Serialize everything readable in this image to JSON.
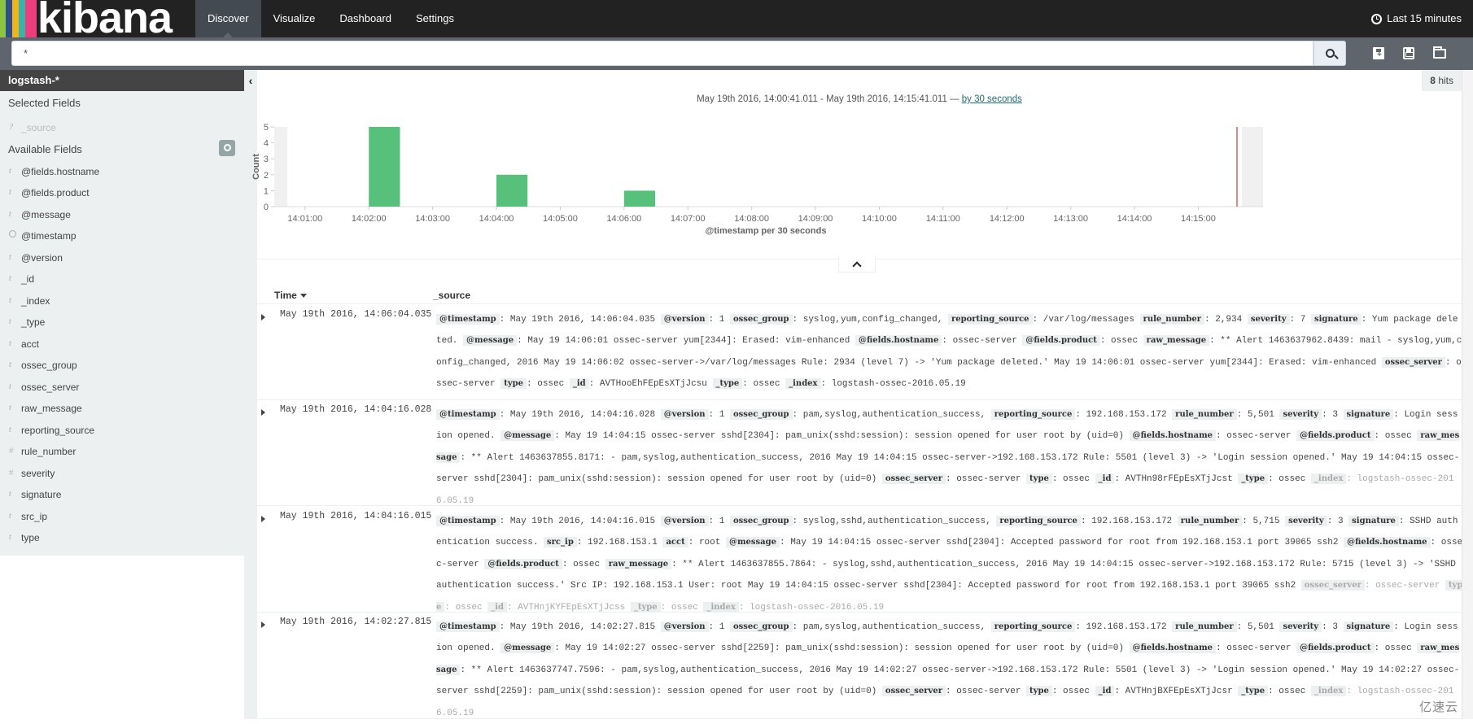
{
  "brand": {
    "name": "kibana",
    "stripe_colors": [
      "#8cc63f",
      "#2e4e8c",
      "#f0b51b",
      "#3bb3a9",
      "#ec3e7f"
    ]
  },
  "nav": {
    "tabs": [
      {
        "label": "Discover",
        "active": true
      },
      {
        "label": "Visualize",
        "active": false
      },
      {
        "label": "Dashboard",
        "active": false
      },
      {
        "label": "Settings",
        "active": false
      }
    ],
    "timepicker": {
      "icon": "clock-icon",
      "label": "Last 15 minutes"
    }
  },
  "search": {
    "query": "*",
    "button_icon": "search-icon",
    "tools": [
      {
        "name": "new-search",
        "icon": "new-document-icon"
      },
      {
        "name": "save-search",
        "icon": "save-icon"
      },
      {
        "name": "open-search",
        "icon": "folder-open-icon"
      }
    ]
  },
  "sidebar": {
    "index_pattern": "logstash-*",
    "selected_title": "Selected Fields",
    "selected_fields": [
      {
        "type": "?",
        "name": "_source"
      }
    ],
    "available_title": "Available Fields",
    "available_fields": [
      {
        "type": "t",
        "name": "@fields.hostname"
      },
      {
        "type": "t",
        "name": "@fields.product"
      },
      {
        "type": "t",
        "name": "@message"
      },
      {
        "type": "clock",
        "name": "@timestamp"
      },
      {
        "type": "t",
        "name": "@version"
      },
      {
        "type": "t",
        "name": "_id"
      },
      {
        "type": "t",
        "name": "_index"
      },
      {
        "type": "t",
        "name": "_type"
      },
      {
        "type": "t",
        "name": "acct"
      },
      {
        "type": "t",
        "name": "ossec_group"
      },
      {
        "type": "t",
        "name": "ossec_server"
      },
      {
        "type": "t",
        "name": "raw_message"
      },
      {
        "type": "t",
        "name": "reporting_source"
      },
      {
        "type": "#",
        "name": "rule_number"
      },
      {
        "type": "#",
        "name": "severity"
      },
      {
        "type": "t",
        "name": "signature"
      },
      {
        "type": "t",
        "name": "src_ip"
      },
      {
        "type": "t",
        "name": "type"
      }
    ]
  },
  "hits": {
    "count": "8",
    "label": "hits"
  },
  "range": {
    "text": "May 19th 2016, 14:00:41.011 - May 19th 2016, 14:15:41.011 — ",
    "interval_link": "by 30 seconds"
  },
  "chart_data": {
    "type": "bar",
    "title": "",
    "xlabel": "@timestamp per 30 seconds",
    "ylabel": "Count",
    "ylim": [
      0,
      5
    ],
    "yticks": [
      0,
      1,
      2,
      3,
      4,
      5
    ],
    "xlim": [
      "14:00:41",
      "14:15:41"
    ],
    "xticks": [
      "14:01:00",
      "14:02:00",
      "14:03:00",
      "14:04:00",
      "14:05:00",
      "14:06:00",
      "14:07:00",
      "14:08:00",
      "14:09:00",
      "14:10:00",
      "14:11:00",
      "14:12:00",
      "14:13:00",
      "14:14:00",
      "14:15:00"
    ],
    "bar_color": "#57c17b",
    "current_time_marker": "14:15:41",
    "categories": [
      "14:02:00",
      "14:04:00",
      "14:06:00"
    ],
    "values": [
      5,
      2,
      1
    ],
    "grid": false,
    "legend": "none"
  },
  "table": {
    "time_header": "Time",
    "source_header": "_source",
    "rows": [
      {
        "time": "May 19th 2016, 14:06:04.035",
        "fields": [
          [
            "@timestamp",
            "May 19th 2016, 14:06:04.035"
          ],
          [
            "@version",
            "1"
          ],
          [
            "ossec_group",
            "syslog,yum,config_changed,"
          ],
          [
            "reporting_source",
            "/var/log/messages"
          ],
          [
            "rule_number",
            "2,934"
          ],
          [
            "severity",
            "7"
          ],
          [
            "signature",
            "Yum package deleted."
          ],
          [
            "@message",
            "May 19 14:06:01 ossec-server yum[2344]: Erased: vim-enhanced"
          ],
          [
            "@fields.hostname",
            "ossec-server"
          ],
          [
            "@fields.product",
            "ossec"
          ],
          [
            "raw_message",
            "** Alert 1463637962.8439: mail - syslog,yum,config_changed, 2016 May 19 14:06:02 ossec-server->/var/log/messages Rule: 2934 (level 7) -> 'Yum package deleted.' May 19 14:06:01 ossec-server yum[2344]: Erased: vim-enhanced"
          ],
          [
            "ossec_server",
            "ossec-server"
          ],
          [
            "type",
            "ossec"
          ],
          [
            "_id",
            "AVTHooEhFEpEsXTjJcsu"
          ],
          [
            "_type",
            "ossec"
          ],
          [
            "_index",
            "logstash-ossec-2016.05.19"
          ]
        ]
      },
      {
        "time": "May 19th 2016, 14:04:16.028",
        "fields": [
          [
            "@timestamp",
            "May 19th 2016, 14:04:16.028"
          ],
          [
            "@version",
            "1"
          ],
          [
            "ossec_group",
            "pam,syslog,authentication_success,"
          ],
          [
            "reporting_source",
            "192.168.153.172"
          ],
          [
            "rule_number",
            "5,501"
          ],
          [
            "severity",
            "3"
          ],
          [
            "signature",
            "Login session opened."
          ],
          [
            "@message",
            "May 19 14:04:15 ossec-server sshd[2304]: pam_unix(sshd:session): session opened for user root by (uid=0)"
          ],
          [
            "@fields.hostname",
            "ossec-server"
          ],
          [
            "@fields.product",
            "ossec"
          ],
          [
            "raw_message",
            "** Alert 1463637855.8171: - pam,syslog,authentication_success, 2016 May 19 14:04:15 ossec-server->192.168.153.172 Rule: 5501 (level 3) -> 'Login session opened.' May 19 14:04:15 ossec-server sshd[2304]: pam_unix(sshd:session): session opened for user root by (uid=0)"
          ],
          [
            "ossec_server",
            "ossec-server"
          ],
          [
            "type",
            "ossec"
          ],
          [
            "_id",
            "AVTHn98rFEpEsXTjJcst"
          ],
          [
            "_type",
            "ossec"
          ],
          [
            "_index",
            "logstash-ossec-2016.05.19"
          ]
        ]
      },
      {
        "time": "May 19th 2016, 14:04:16.015",
        "fields": [
          [
            "@timestamp",
            "May 19th 2016, 14:04:16.015"
          ],
          [
            "@version",
            "1"
          ],
          [
            "ossec_group",
            "syslog,sshd,authentication_success,"
          ],
          [
            "reporting_source",
            "192.168.153.172"
          ],
          [
            "rule_number",
            "5,715"
          ],
          [
            "severity",
            "3"
          ],
          [
            "signature",
            "SSHD authentication success."
          ],
          [
            "src_ip",
            "192.168.153.1"
          ],
          [
            "acct",
            "root"
          ],
          [
            "@message",
            "May 19 14:04:15 ossec-server sshd[2304]: Accepted password for root from 192.168.153.1 port 39065 ssh2"
          ],
          [
            "@fields.hostname",
            "ossec-server"
          ],
          [
            "@fields.product",
            "ossec"
          ],
          [
            "raw_message",
            "** Alert 1463637855.7864: - syslog,sshd,authentication_success, 2016 May 19 14:04:15 ossec-server->192.168.153.172 Rule: 5715 (level 3) -> 'SSHD authentication success.' Src IP: 192.168.153.1 User: root May 19 14:04:15 ossec-server sshd[2304]: Accepted password for root from 192.168.153.1 port 39065 ssh2"
          ],
          [
            "ossec_server",
            "ossec-server"
          ],
          [
            "type",
            "ossec"
          ],
          [
            "_id",
            "AVTHnjKYFEpEsXTjJcss"
          ],
          [
            "_type",
            "ossec"
          ],
          [
            "_index",
            "logstash-ossec-2016.05.19"
          ]
        ]
      },
      {
        "time": "May 19th 2016, 14:02:27.815",
        "fields": [
          [
            "@timestamp",
            "May 19th 2016, 14:02:27.815"
          ],
          [
            "@version",
            "1"
          ],
          [
            "ossec_group",
            "pam,syslog,authentication_success,"
          ],
          [
            "reporting_source",
            "192.168.153.172"
          ],
          [
            "rule_number",
            "5,501"
          ],
          [
            "severity",
            "3"
          ],
          [
            "signature",
            "Login session opened."
          ],
          [
            "@message",
            "May 19 14:02:27 ossec-server sshd[2259]: pam_unix(sshd:session): session opened for user root by (uid=0)"
          ],
          [
            "@fields.hostname",
            "ossec-server"
          ],
          [
            "@fields.product",
            "ossec"
          ],
          [
            "raw_message",
            "** Alert 1463637747.7596: - pam,syslog,authentication_success, 2016 May 19 14:02:27 ossec-server->192.168.153.172 Rule: 5501 (level 3) -> 'Login session opened.' May 19 14:02:27 ossec-server sshd[2259]: pam_unix(sshd:session): session opened for user root by (uid=0)"
          ],
          [
            "ossec_server",
            "ossec-server"
          ],
          [
            "type",
            "ossec"
          ],
          [
            "_id",
            "AVTHnjBXFEpEsXTjJcsr"
          ],
          [
            "_type",
            "ossec"
          ],
          [
            "_index",
            "logstash-ossec-2016.05.19"
          ]
        ]
      }
    ]
  },
  "watermark": "亿速云"
}
